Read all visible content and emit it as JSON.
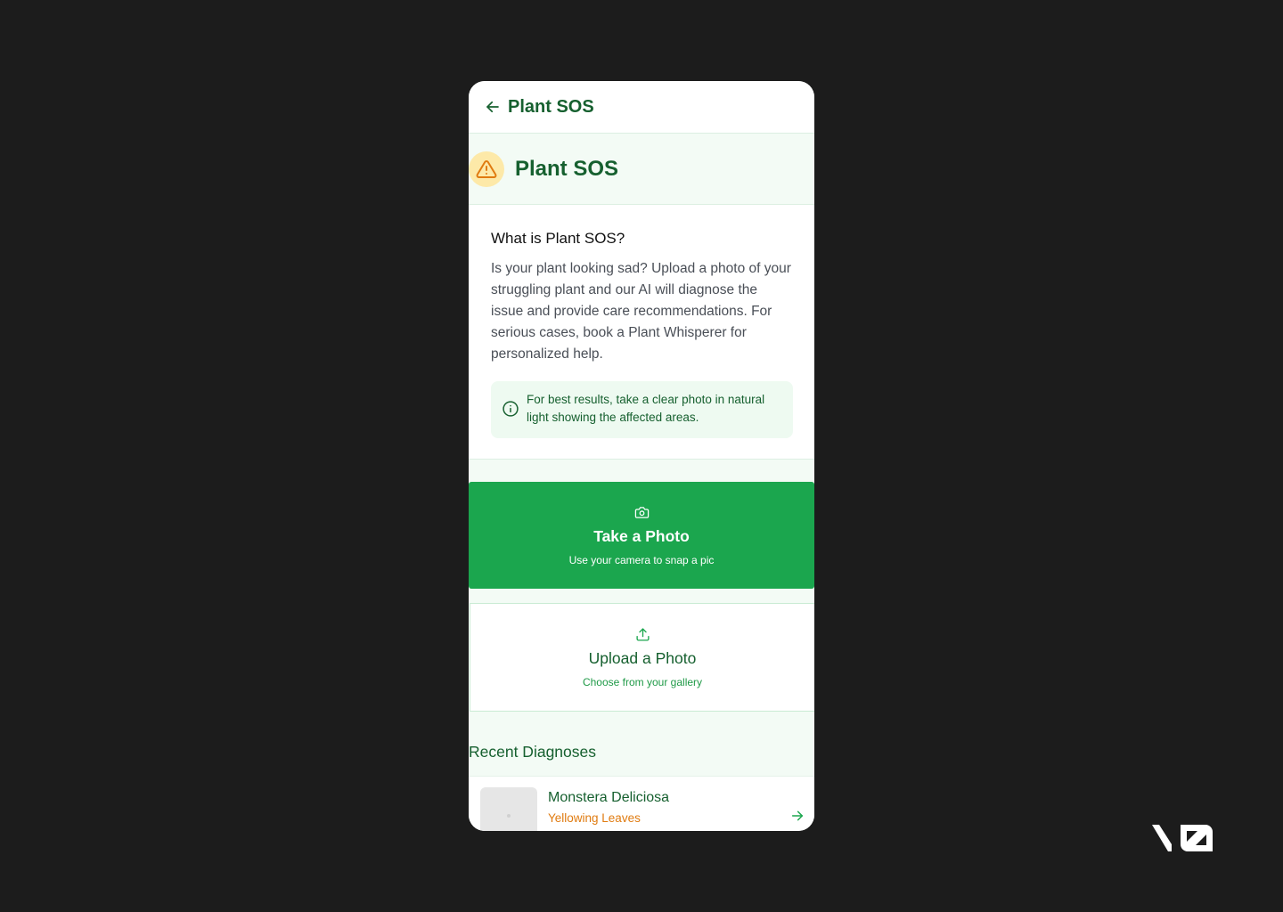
{
  "header": {
    "title": "Plant SOS"
  },
  "hero": {
    "title": "Plant SOS",
    "icon": "warning-icon"
  },
  "info": {
    "title": "What is Plant SOS?",
    "body": "Is your plant looking sad? Upload a photo of your struggling plant and our AI will diagnose the issue and provide care recommendations. For serious cases, book a Plant Whisperer for personalized help.",
    "tip": "For best results, take a clear photo in natural light showing the affected areas."
  },
  "actions": {
    "take_photo": {
      "title": "Take a Photo",
      "subtitle": "Use your camera to snap a pic"
    },
    "upload_photo": {
      "title": "Upload a Photo",
      "subtitle": "Choose from your gallery"
    }
  },
  "recent": {
    "heading": "Recent Diagnoses",
    "items": [
      {
        "name": "Monstera Deliciosa",
        "issue": "Yellowing Leaves"
      }
    ]
  },
  "colors": {
    "primary_green": "#1ba64e",
    "dark_green": "#16602f",
    "warning_amber": "#e07b10",
    "page_background": "#1c1c1c"
  }
}
